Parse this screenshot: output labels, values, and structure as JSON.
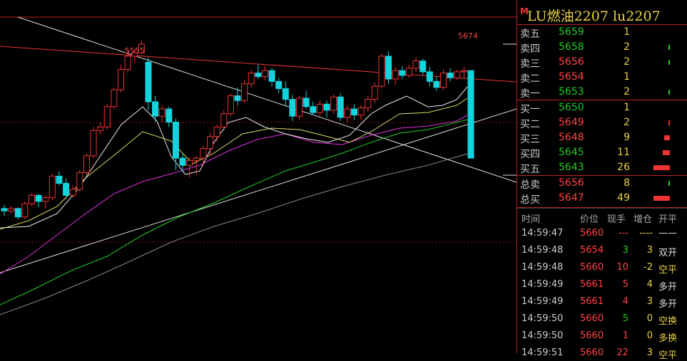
{
  "header": {
    "marker": "M",
    "title": "LU燃油2207  lu2207"
  },
  "chart": {
    "high_label": "5555",
    "top_label": "5674",
    "candles": [
      [
        5618,
        5621,
        5612,
        5616
      ],
      [
        5616,
        5620,
        5614,
        5618
      ],
      [
        5618,
        5619,
        5609,
        5611
      ],
      [
        5611,
        5624,
        5609,
        5622
      ],
      [
        5622,
        5631,
        5620,
        5629
      ],
      [
        5629,
        5630,
        5619,
        5624
      ],
      [
        5624,
        5629,
        5618,
        5627
      ],
      [
        5627,
        5647,
        5625,
        5645
      ],
      [
        5645,
        5649,
        5637,
        5639
      ],
      [
        5639,
        5643,
        5626,
        5629
      ],
      [
        5629,
        5637,
        5627,
        5634
      ],
      [
        5634,
        5650,
        5632,
        5648
      ],
      [
        5648,
        5664,
        5646,
        5662
      ],
      [
        5662,
        5686,
        5660,
        5683
      ],
      [
        5683,
        5690,
        5680,
        5686
      ],
      [
        5686,
        5705,
        5684,
        5703
      ],
      [
        5703,
        5719,
        5701,
        5717
      ],
      [
        5717,
        5738,
        5715,
        5734
      ],
      [
        5734,
        5750,
        5731,
        5745
      ],
      [
        5745,
        5751,
        5740,
        5748
      ],
      [
        5748,
        5758,
        5747,
        5755
      ],
      [
        5740,
        5744,
        5700,
        5707
      ],
      [
        5707,
        5712,
        5690,
        5695
      ],
      [
        5695,
        5704,
        5690,
        5701
      ],
      [
        5701,
        5703,
        5686,
        5690
      ],
      [
        5690,
        5693,
        5650,
        5660
      ],
      [
        5660,
        5664,
        5648,
        5654
      ],
      [
        5654,
        5661,
        5644,
        5658
      ],
      [
        5658,
        5662,
        5646,
        5660
      ],
      [
        5660,
        5670,
        5654,
        5668
      ],
      [
        5668,
        5681,
        5662,
        5678
      ],
      [
        5678,
        5688,
        5674,
        5686
      ],
      [
        5686,
        5700,
        5683,
        5697
      ],
      [
        5697,
        5714,
        5695,
        5712
      ],
      [
        5712,
        5719,
        5704,
        5708
      ],
      [
        5708,
        5725,
        5706,
        5722
      ],
      [
        5722,
        5734,
        5719,
        5731
      ],
      [
        5731,
        5738,
        5726,
        5728
      ],
      [
        5728,
        5737,
        5725,
        5733
      ],
      [
        5733,
        5735,
        5720,
        5724
      ],
      [
        5724,
        5727,
        5714,
        5718
      ],
      [
        5718,
        5724,
        5703,
        5709
      ],
      [
        5709,
        5713,
        5691,
        5695
      ],
      [
        5695,
        5712,
        5692,
        5710
      ],
      [
        5710,
        5716,
        5701,
        5703
      ],
      [
        5703,
        5707,
        5696,
        5698
      ],
      [
        5698,
        5708,
        5695,
        5705
      ],
      [
        5705,
        5708,
        5694,
        5700
      ],
      [
        5700,
        5713,
        5697,
        5711
      ],
      [
        5711,
        5714,
        5691,
        5694
      ],
      [
        5694,
        5704,
        5690,
        5701
      ],
      [
        5701,
        5705,
        5692,
        5696
      ],
      [
        5696,
        5704,
        5692,
        5702
      ],
      [
        5702,
        5712,
        5699,
        5709
      ],
      [
        5709,
        5723,
        5706,
        5720
      ],
      [
        5720,
        5747,
        5718,
        5745
      ],
      [
        5745,
        5749,
        5722,
        5726
      ],
      [
        5726,
        5736,
        5721,
        5733
      ],
      [
        5733,
        5737,
        5726,
        5729
      ],
      [
        5729,
        5738,
        5727,
        5735
      ],
      [
        5735,
        5744,
        5732,
        5741
      ],
      [
        5741,
        5743,
        5729,
        5732
      ],
      [
        5732,
        5736,
        5720,
        5724
      ],
      [
        5724,
        5728,
        5716,
        5719
      ],
      [
        5719,
        5734,
        5717,
        5731
      ],
      [
        5731,
        5735,
        5724,
        5727
      ],
      [
        5727,
        5734,
        5725,
        5732
      ],
      [
        5732,
        5736,
        5727,
        5733
      ],
      [
        5733,
        5664,
        5730,
        5660
      ]
    ]
  },
  "orderbook": {
    "asks": [
      {
        "label": "卖五",
        "price": "5659",
        "qty": "1",
        "bar": 0.0
      },
      {
        "label": "卖四",
        "price": "5658",
        "qty": "2",
        "bar": 0.05
      },
      {
        "label": "卖三",
        "price": "5656",
        "qty": "2",
        "bar": 0.05
      },
      {
        "label": "卖二",
        "price": "5654",
        "qty": "1",
        "bar": 0.0
      },
      {
        "label": "卖一",
        "price": "5653",
        "qty": "2",
        "bar": 0.05
      }
    ],
    "bids": [
      {
        "label": "买一",
        "price": "5650",
        "qty": "1",
        "bar": 0.0
      },
      {
        "label": "买二",
        "price": "5649",
        "qty": "2",
        "bar": 0.05
      },
      {
        "label": "买三",
        "price": "5648",
        "qty": "9",
        "bar": 0.22
      },
      {
        "label": "买四",
        "price": "5645",
        "qty": "11",
        "bar": 0.27
      },
      {
        "label": "买五",
        "price": "5643",
        "qty": "26",
        "bar": 0.65
      }
    ],
    "totals": [
      {
        "label": "总卖",
        "price": "5656",
        "qty": "8",
        "bar": 0.05
      },
      {
        "label": "总买",
        "price": "5647",
        "qty": "49",
        "bar": 0.65
      }
    ]
  },
  "trades": {
    "headers": [
      "时间",
      "价位",
      "现手",
      "增仓",
      "开平"
    ],
    "rows": [
      {
        "time": "14:59:47",
        "price": "5660",
        "vol": "---",
        "oi": "----",
        "kind": "——"
      },
      {
        "time": "14:59:48",
        "price": "5654",
        "vol": "3",
        "oi": "3",
        "kind": "双开"
      },
      {
        "time": "14:59:48",
        "price": "5660",
        "vol": "10",
        "oi": "-2",
        "kind": "空平"
      },
      {
        "time": "14:59:49",
        "price": "5661",
        "vol": "5",
        "oi": "4",
        "kind": "多开"
      },
      {
        "time": "14:59:49",
        "price": "5661",
        "vol": "4",
        "oi": "3",
        "kind": "多开"
      },
      {
        "time": "14:59:50",
        "price": "5660",
        "vol": "5",
        "oi": "0",
        "kind": "空换"
      },
      {
        "time": "14:59:50",
        "price": "5660",
        "vol": "1",
        "oi": "0",
        "kind": "多换"
      },
      {
        "time": "14:59:51",
        "price": "5660",
        "vol": "22",
        "oi": "3",
        "kind": "空平"
      }
    ]
  },
  "colors": {
    "up": "#e33",
    "down": "#13d4dc",
    "accent": "#e8d24a"
  }
}
